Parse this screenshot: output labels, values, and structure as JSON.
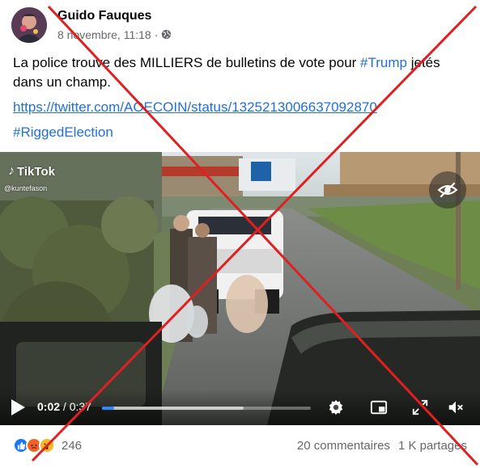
{
  "post": {
    "author": "Guido Fauques",
    "date": "8 novembre, 11:18",
    "separator": "·",
    "visibility_icon": "globe-icon",
    "text_before": "La police trouve des MILLIERS de bulletins de vote pour ",
    "text_hashtag": "#Trump",
    "text_after": " jetés dans un champ.",
    "link": "https://twitter.com/AOECOIN/status/1325213006637092870",
    "hashtag": "#RiggedElection"
  },
  "video": {
    "watermark": "TikTok",
    "watermark_user": "@kuntefason",
    "current_time": "0:02",
    "time_separator": " / ",
    "total_time": "0:37",
    "played_fraction": 0.06,
    "loaded_fraction": 0.68,
    "icons": [
      "play-icon",
      "settings-icon",
      "picture-in-picture-icon",
      "fullscreen-icon",
      "mute-icon",
      "eye-slash-icon"
    ]
  },
  "footer": {
    "reaction_count": "246",
    "comments": "20 commentaires",
    "shares": "1 K partages",
    "reaction_icons": [
      "like-icon",
      "angry-icon",
      "wow-icon"
    ]
  },
  "colors": {
    "link": "#216fdb",
    "cross": "#e02020",
    "secondary_text": "#65676b",
    "progress": "#2d88ff"
  }
}
